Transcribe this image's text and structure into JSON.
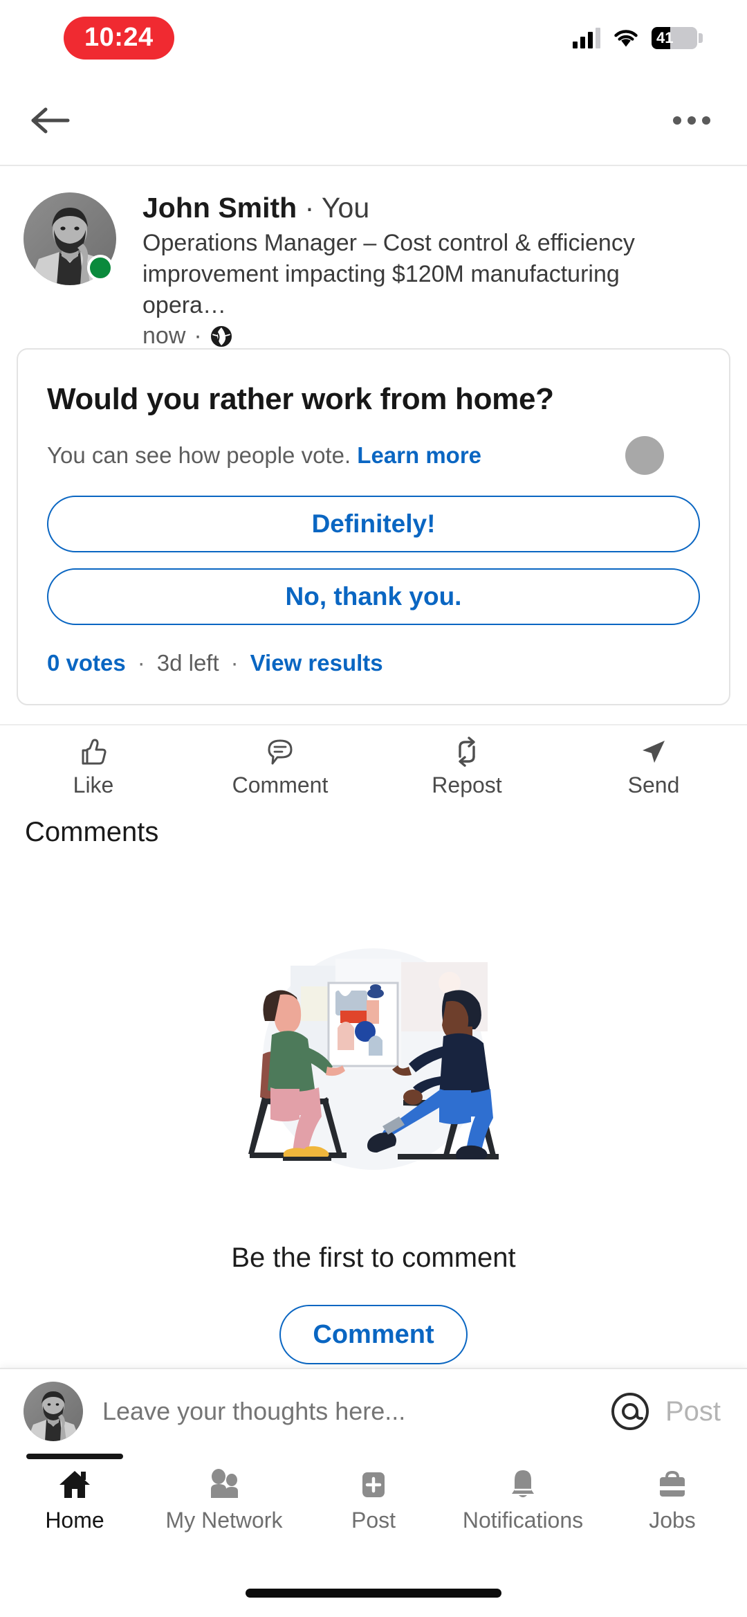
{
  "status_bar": {
    "time": "10:24",
    "battery_percent": "41",
    "battery_level": 41,
    "icons": [
      "cellular-signal-icon",
      "wifi-icon",
      "battery-icon"
    ]
  },
  "top_nav": {
    "back_icon": "back-arrow-icon",
    "overflow_icon": "more-options-icon"
  },
  "post": {
    "author": {
      "name": "John Smith",
      "relationship": "· You",
      "headline": "Operations Manager – Cost control & efficiency improvement impacting $120M manufacturing opera…",
      "timestamp": "now",
      "meta_separator": "·",
      "visibility_icon": "globe-icon",
      "presence": "online"
    },
    "poll": {
      "question": "Would you rather work from home?",
      "subtext": "You can see how people vote.",
      "learn_more": "Learn more",
      "options": [
        {
          "label": "Definitely!"
        },
        {
          "label": "No, thank you."
        }
      ],
      "votes": "0 votes",
      "separator": "·",
      "time_left": "3d left",
      "view_results": "View results"
    },
    "actions": [
      {
        "label": "Like",
        "icon": "thumbs-up-icon"
      },
      {
        "label": "Comment",
        "icon": "comment-bubble-icon"
      },
      {
        "label": "Repost",
        "icon": "repost-icon"
      },
      {
        "label": "Send",
        "icon": "send-paper-plane-icon"
      }
    ]
  },
  "comments_section": {
    "title": "Comments",
    "empty_illustration": "two-people-conversation-illustration",
    "empty_text": "Be the first to comment",
    "empty_button": "Comment"
  },
  "comment_bar": {
    "avatar": "user-avatar",
    "placeholder": "Leave your thoughts here...",
    "mention_icon": "at-mention-icon",
    "post_label": "Post"
  },
  "bottom_nav": {
    "items": [
      {
        "label": "Home",
        "icon": "home-icon",
        "active": true
      },
      {
        "label": "My Network",
        "icon": "people-icon",
        "active": false
      },
      {
        "label": "Post",
        "icon": "plus-square-icon",
        "active": false
      },
      {
        "label": "Notifications",
        "icon": "bell-icon",
        "active": false
      },
      {
        "label": "Jobs",
        "icon": "briefcase-icon",
        "active": false
      }
    ]
  },
  "colors": {
    "linkedin_blue": "#0a66c2",
    "recording_red": "#f02a31",
    "online_green": "#0a8a3c",
    "text_primary": "#171717",
    "text_secondary": "#5d5d5d",
    "nav_inactive": "#6f6f6f"
  }
}
